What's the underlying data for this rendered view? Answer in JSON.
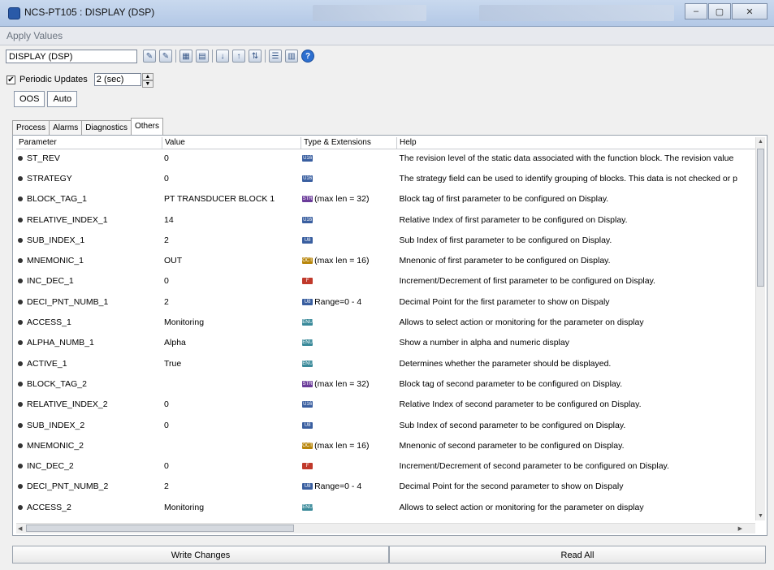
{
  "window": {
    "title": "NCS-PT105 : DISPLAY (DSP)"
  },
  "menu": {
    "apply_values": "Apply Values"
  },
  "toolbar": {
    "block": "DISPLAY (DSP)"
  },
  "periodic": {
    "label": "Periodic Updates",
    "checked": "✔",
    "interval": "2 (sec)"
  },
  "modes": [
    "OOS",
    "Auto"
  ],
  "tabs": [
    "Process",
    "Alarms",
    "Diagnostics",
    "Others"
  ],
  "grid": {
    "headers": {
      "parameter": "Parameter",
      "value": "Value",
      "type": "Type & Extensions",
      "help": "Help"
    },
    "rows": [
      {
        "param": "ST_REV",
        "value": "0",
        "badge": "U16",
        "ext": "",
        "help": "The revision level of the static data associated with the function block.  The revision value"
      },
      {
        "param": "STRATEGY",
        "value": "0",
        "badge": "U16",
        "ext": "",
        "help": "The strategy field can be used to identify grouping of blocks.  This data is not checked or p"
      },
      {
        "param": "BLOCK_TAG_1",
        "value": "PT TRANSDUCER BLOCK 1",
        "badge": "STR",
        "ext": "(max len = 32)",
        "help": "Block tag of first parameter to be configured on Display."
      },
      {
        "param": "RELATIVE_INDEX_1",
        "value": "14",
        "badge": "U16",
        "ext": "",
        "help": "Relative Index of first parameter to be configured on Display."
      },
      {
        "param": "SUB_INDEX_1",
        "value": "2",
        "badge": "U8",
        "ext": "",
        "help": "Sub Index of first parameter to be configured on Display."
      },
      {
        "param": "MNEMONIC_1",
        "value": "OUT",
        "badge": "OCT",
        "ext": "(max len = 16)",
        "help": "Mnenonic of first parameter to be configured on Display."
      },
      {
        "param": "INC_DEC_1",
        "value": "0",
        "badge": "F",
        "ext": "",
        "help": "Increment/Decrement of first parameter to be configured on Display."
      },
      {
        "param": "DECI_PNT_NUMB_1",
        "value": "2",
        "badge": "U8",
        "ext": "Range=0 - 4",
        "help": "Decimal Point for the first parameter to show on Dispaly"
      },
      {
        "param": "ACCESS_1",
        "value": "Monitoring",
        "badge": "ENU",
        "ext": "",
        "help": "Allows to select action or monitoring for the parameter on display"
      },
      {
        "param": "ALPHA_NUMB_1",
        "value": "Alpha",
        "badge": "ENU",
        "ext": "",
        "help": "Show a number in alpha and numeric display"
      },
      {
        "param": "ACTIVE_1",
        "value": "True",
        "badge": "ENU",
        "ext": "",
        "help": "Determines whether the parameter should be displayed."
      },
      {
        "param": "BLOCK_TAG_2",
        "value": "",
        "badge": "STR",
        "ext": "(max len = 32)",
        "help": "Block tag of second parameter to be configured on Display."
      },
      {
        "param": "RELATIVE_INDEX_2",
        "value": "0",
        "badge": "U16",
        "ext": "",
        "help": "Relative Index of second parameter to be configured on Display."
      },
      {
        "param": "SUB_INDEX_2",
        "value": "0",
        "badge": "U8",
        "ext": "",
        "help": "Sub Index of second parameter to be configured on Display."
      },
      {
        "param": "MNEMONIC_2",
        "value": "",
        "badge": "OCT",
        "ext": "(max len = 16)",
        "help": "Mnenonic of second parameter to be configured on Display."
      },
      {
        "param": "INC_DEC_2",
        "value": "0",
        "badge": "F",
        "ext": "",
        "help": "Increment/Decrement of second parameter to be configured on Display."
      },
      {
        "param": "DECI_PNT_NUMB_2",
        "value": "2",
        "badge": "U8",
        "ext": "Range=0 - 4",
        "help": "Decimal Point for the second parameter to show on Dispaly"
      },
      {
        "param": "ACCESS_2",
        "value": "Monitoring",
        "badge": "ENU",
        "ext": "",
        "help": "Allows to select action or monitoring for the parameter on display"
      }
    ]
  },
  "buttons": {
    "write": "Write Changes",
    "read": "Read All"
  },
  "colors": {
    "badge_u16": "#3a5fa0",
    "badge_str": "#6b3c9a",
    "badge_oct": "#b8860b",
    "badge_f": "#c0392b",
    "badge_enu": "#3a8a9a"
  }
}
